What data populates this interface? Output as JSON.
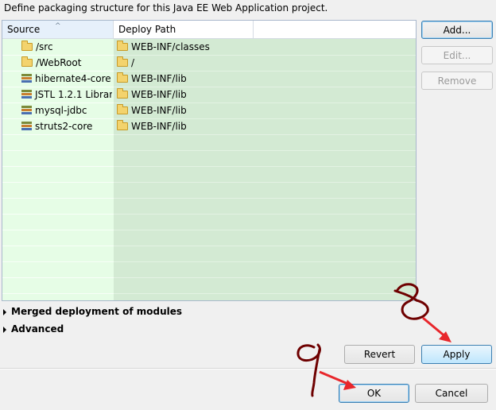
{
  "description": "Define packaging structure for this Java EE Web Application project.",
  "table": {
    "columns": [
      "Source",
      "Deploy Path"
    ],
    "rows": [
      {
        "source": "/src",
        "source_icon": "folder-icon",
        "deploy": "WEB-INF/classes"
      },
      {
        "source": "/WebRoot",
        "source_icon": "folder-icon",
        "deploy": "/"
      },
      {
        "source": "hibernate4-core",
        "source_icon": "library-icon",
        "deploy": "WEB-INF/lib"
      },
      {
        "source": "JSTL 1.2.1 Librar",
        "source_icon": "library-icon",
        "deploy": "WEB-INF/lib"
      },
      {
        "source": "mysql-jdbc",
        "source_icon": "library-icon",
        "deploy": "WEB-INF/lib"
      },
      {
        "source": "struts2-core",
        "source_icon": "library-icon",
        "deploy": "WEB-INF/lib"
      }
    ]
  },
  "side_buttons": {
    "add": "Add...",
    "edit": "Edit...",
    "remove": "Remove"
  },
  "sections": {
    "merged": "Merged deployment of modules",
    "advanced": "Advanced"
  },
  "actions": {
    "revert": "Revert",
    "apply": "Apply",
    "ok": "OK",
    "cancel": "Cancel"
  },
  "colors": {
    "source_column_bg": "#e6fde6",
    "deploy_column_bg": "#d3ead3",
    "annotation_red": "#7a0000",
    "arrow_red": "#e8262b"
  }
}
